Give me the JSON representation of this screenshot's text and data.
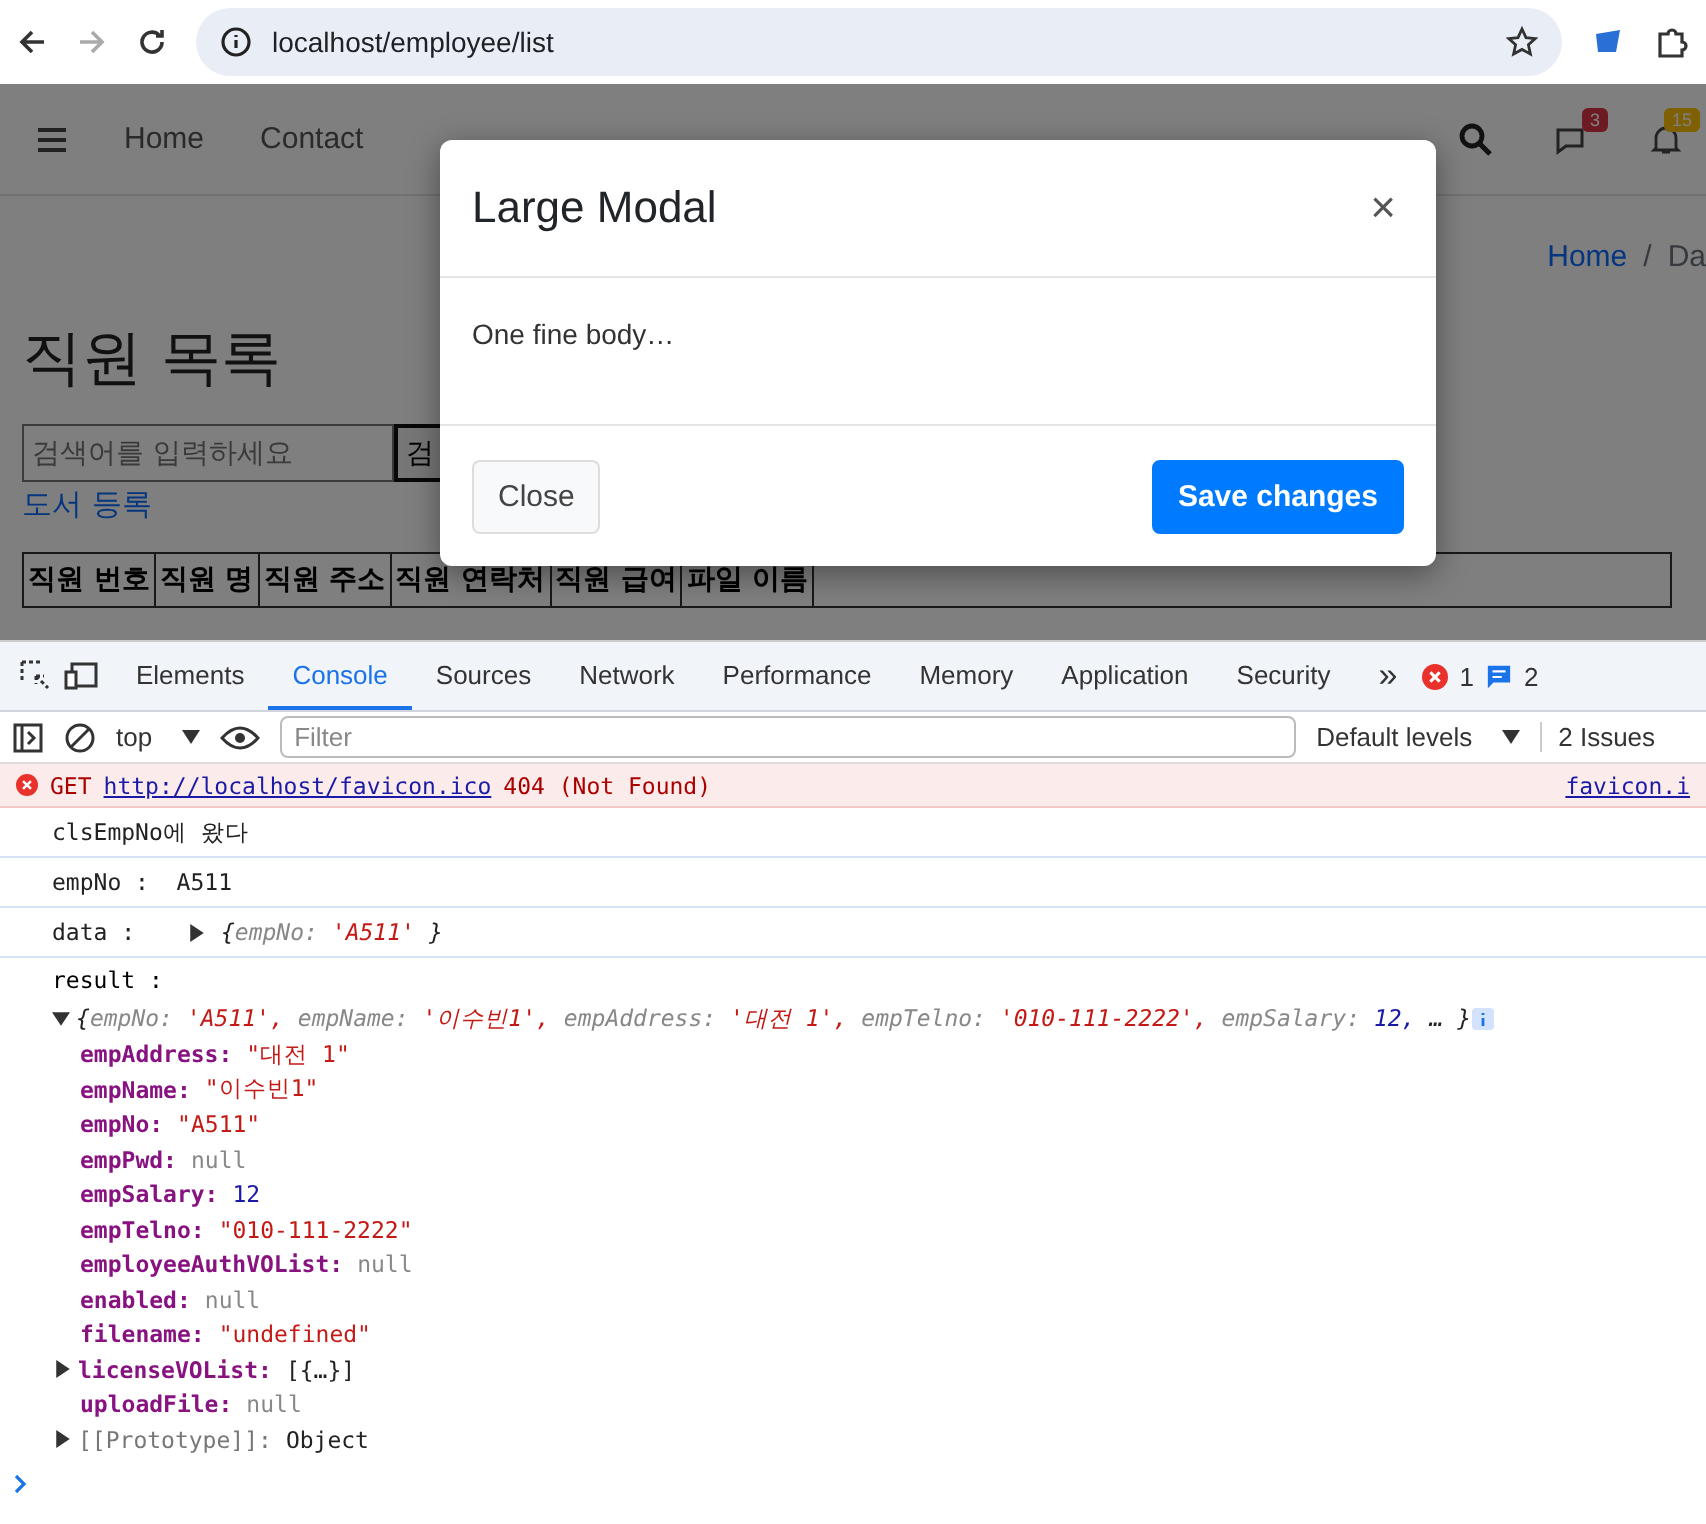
{
  "browser": {
    "url": "localhost/employee/list"
  },
  "navbar": {
    "links": [
      "Home",
      "Contact"
    ],
    "chat_badge": "3",
    "bell_badge": "15"
  },
  "breadcrumb": {
    "home": "Home",
    "separator": "/",
    "current": "Da"
  },
  "page": {
    "title": "직원 목록",
    "search_placeholder": "검색어를 입력하세요",
    "search_button": "검",
    "register_link": "도서 등록"
  },
  "table": {
    "columns": [
      "직원 번호",
      "직원 명",
      "직원 주소",
      "직원 연락처",
      "직원 급여",
      "파일 이름"
    ]
  },
  "modal": {
    "title": "Large Modal",
    "close_icon": "×",
    "body": "One fine body…",
    "buttons": [
      {
        "label": "Close",
        "kind": "secondary"
      },
      {
        "label": "Save changes",
        "kind": "primary"
      }
    ]
  },
  "devtools": {
    "tabs": [
      {
        "label": "Elements",
        "selected": false
      },
      {
        "label": "Console",
        "selected": true
      },
      {
        "label": "Sources",
        "selected": false
      },
      {
        "label": "Network",
        "selected": false
      },
      {
        "label": "Performance",
        "selected": false
      },
      {
        "label": "Memory",
        "selected": false
      },
      {
        "label": "Application",
        "selected": false
      },
      {
        "label": "Security",
        "selected": false
      }
    ],
    "more": "»",
    "error_count": "1",
    "message_count": "2",
    "context": "top",
    "filter_placeholder": "Filter",
    "levels": "Default levels",
    "issues": "2 Issues"
  },
  "console": {
    "error": {
      "method": "GET",
      "url": "http://localhost/favicon.ico",
      "status": "404 (Not Found)",
      "source": "favicon.i"
    },
    "logs": [
      {
        "kind": "text",
        "text": "clsEmpNo에 왔다"
      },
      {
        "kind": "text",
        "text": "empNo :  A511"
      },
      {
        "kind": "object",
        "label": "data : ",
        "expanded": false,
        "preview": {
          "open": "{",
          "close": "}",
          "entries": [
            {
              "key": "empNo:",
              "value": "'A511'",
              "kind": "string"
            }
          ]
        }
      }
    ],
    "result": {
      "label": "result :",
      "expanded": true,
      "preview": {
        "open": "{",
        "close": "}",
        "entries": [
          {
            "key": "empNo:",
            "value": "'A511',",
            "kind": "string"
          },
          {
            "key": "empName:",
            "value": "'이수빈1',",
            "kind": "string"
          },
          {
            "key": "empAddress:",
            "value": "'대전 1',",
            "kind": "string"
          },
          {
            "key": "empTelno:",
            "value": "'010-111-2222',",
            "kind": "string"
          },
          {
            "key": "empSalary:",
            "value": "12,",
            "kind": "number"
          }
        ],
        "more": "…"
      },
      "properties": [
        {
          "key": "empAddress:",
          "value": "\"대전 1\"",
          "kind": "string"
        },
        {
          "key": "empName:",
          "value": "\"이수빈1\"",
          "kind": "string"
        },
        {
          "key": "empNo:",
          "value": "\"A511\"",
          "kind": "string"
        },
        {
          "key": "empPwd:",
          "value": "null",
          "kind": "null"
        },
        {
          "key": "empSalary:",
          "value": "12",
          "kind": "number"
        },
        {
          "key": "empTelno:",
          "value": "\"010-111-2222\"",
          "kind": "string"
        },
        {
          "key": "employeeAuthVOList:",
          "value": "null",
          "kind": "null"
        },
        {
          "key": "enabled:",
          "value": "null",
          "kind": "null"
        },
        {
          "key": "filename:",
          "value": "\"undefined\"",
          "kind": "string"
        },
        {
          "key": "licenseVOList:",
          "value": "[{…}]",
          "kind": "object",
          "expanded": false
        },
        {
          "key": "uploadFile:",
          "value": "null",
          "kind": "null"
        },
        {
          "key": "[[Prototype]]:",
          "value": "Object",
          "kind": "proto",
          "expanded": false
        }
      ]
    }
  }
}
